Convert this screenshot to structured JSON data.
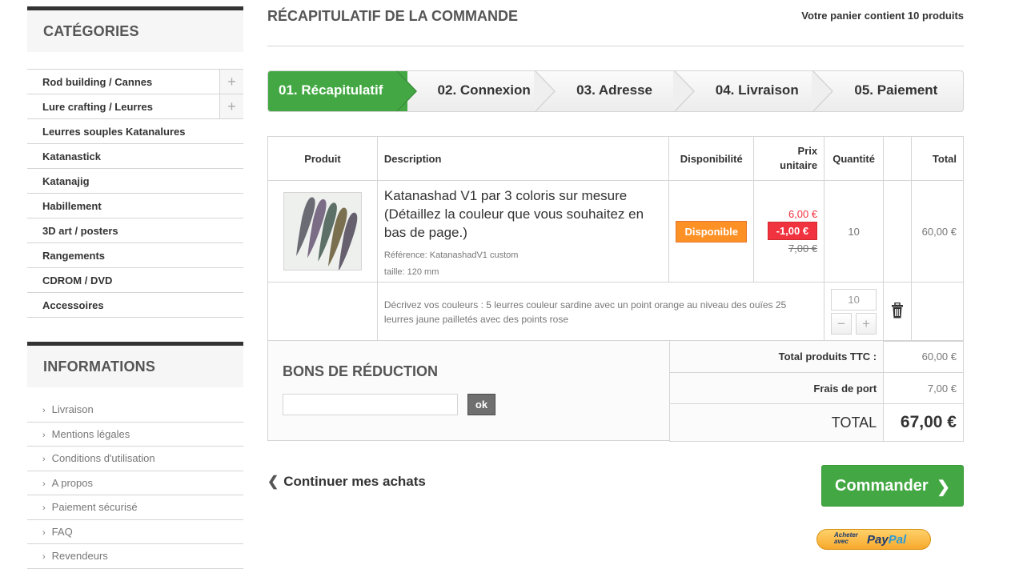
{
  "sidebar": {
    "categories_title": "CATÉGORIES",
    "categories": [
      {
        "label": "Rod building / Cannes",
        "expandable": true
      },
      {
        "label": "Lure crafting / Leurres",
        "expandable": true
      },
      {
        "label": "Leurres souples Katanalures"
      },
      {
        "label": "Katanastick"
      },
      {
        "label": "Katanajig"
      },
      {
        "label": "Habillement"
      },
      {
        "label": "3D art / posters"
      },
      {
        "label": "Rangements"
      },
      {
        "label": "CDROM / DVD"
      },
      {
        "label": "Accessoires"
      }
    ],
    "expand_icon": "+",
    "informations_title": "INFORMATIONS",
    "informations": [
      "Livraison",
      "Mentions légales",
      "Conditions d'utilisation",
      "A propos",
      "Paiement sécurisé",
      "FAQ",
      "Revendeurs"
    ]
  },
  "header": {
    "title": "RÉCAPITULATIF DE LA COMMANDE",
    "cart_count": "Votre panier contient 10 produits"
  },
  "steps": [
    "01. Récapitulatif",
    "02. Connexion",
    "03. Adresse",
    "04. Livraison",
    "05. Paiement"
  ],
  "active_step": 0,
  "table": {
    "headers": {
      "product": "Produit",
      "description": "Description",
      "availability": "Disponibilité",
      "unit_price": "Prix unitaire",
      "quantity": "Quantité",
      "total": "Total"
    },
    "item": {
      "name": "Katanashad V1 par 3 coloris sur mesure (Détaillez la couleur que vous souhaitez en bas de page.)",
      "reference": "Référence: KatanashadV1 custom",
      "size": "taille: 120 mm",
      "availability": "Disponible",
      "price_new": "6,00 €",
      "discount": "-1,00 €",
      "price_old": "7,00 €",
      "quantity": "10",
      "total": "60,00 €"
    },
    "customization": {
      "text": "Décrivez vos couleurs : 5 leurres couleur sardine avec un point orange au niveau des ouïes 25 leurres jaune pailletés avec des points rose",
      "quantity": "10",
      "minus": "−",
      "plus": "+"
    }
  },
  "voucher": {
    "title": "BONS DE RÉDUCTION",
    "input_value": "",
    "button": "ok"
  },
  "summary": {
    "products_label": "Total produits TTC :",
    "products_value": "60,00 €",
    "shipping_label": "Frais de port",
    "shipping_value": "7,00 €",
    "total_label": "TOTAL",
    "total_value": "67,00 €"
  },
  "actions": {
    "continue": "Continuer mes achats",
    "order": "Commander",
    "chevron_left": "❮",
    "chevron_right": "❯",
    "paypal_small_1": "Acheter",
    "paypal_small_2": "avec",
    "paypal_brand_1": "Pay",
    "paypal_brand_2": "Pal"
  },
  "colors": {
    "accent_green": "#43a844",
    "discount_red": "#f13340",
    "badge_orange": "#fe9126"
  }
}
